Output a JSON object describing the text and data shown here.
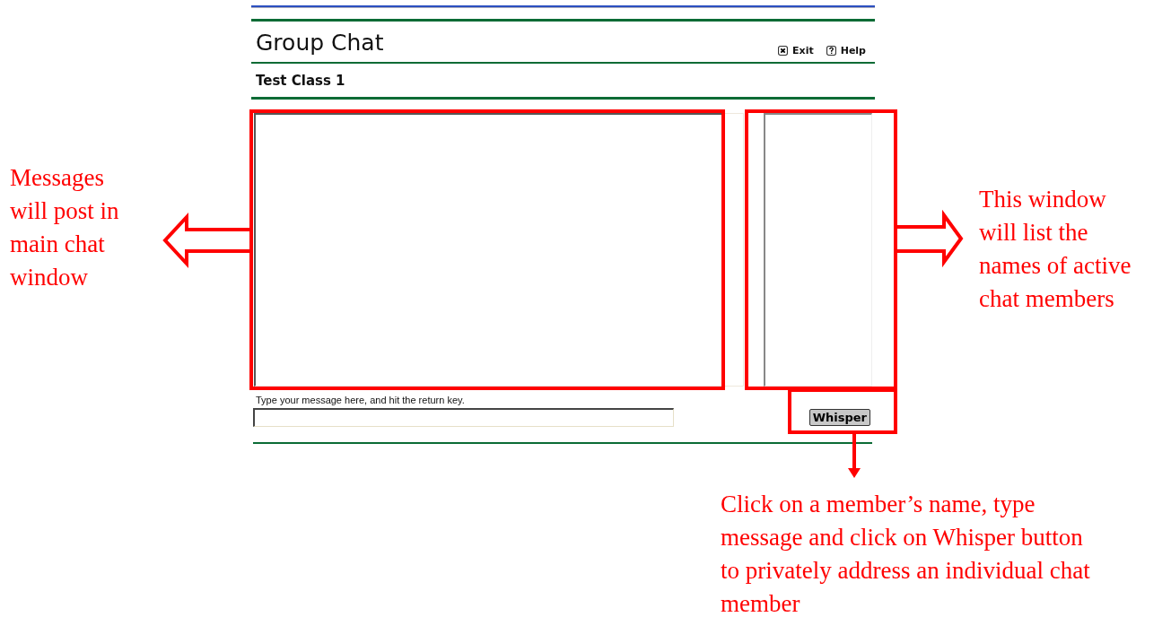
{
  "header": {
    "title": "Group Chat",
    "links": [
      {
        "kind": "exit",
        "label": "Exit"
      },
      {
        "kind": "help",
        "label": "Help"
      }
    ]
  },
  "course": "Test Class 1",
  "composer": {
    "prompt": "Type your message here, and hit the return key.",
    "button": "Whisper"
  },
  "annotations": [
    {
      "kind": "left",
      "lines": [
        "Messages",
        "will post in",
        "main chat",
        "window"
      ]
    },
    {
      "kind": "right",
      "lines": [
        "This window",
        "will list the",
        "names of active",
        "chat members"
      ]
    },
    {
      "kind": "bottom",
      "lines": [
        "Click on a member’s name, type",
        "message and click on Whisper button",
        "to privately address an individual chat",
        "member"
      ]
    }
  ]
}
